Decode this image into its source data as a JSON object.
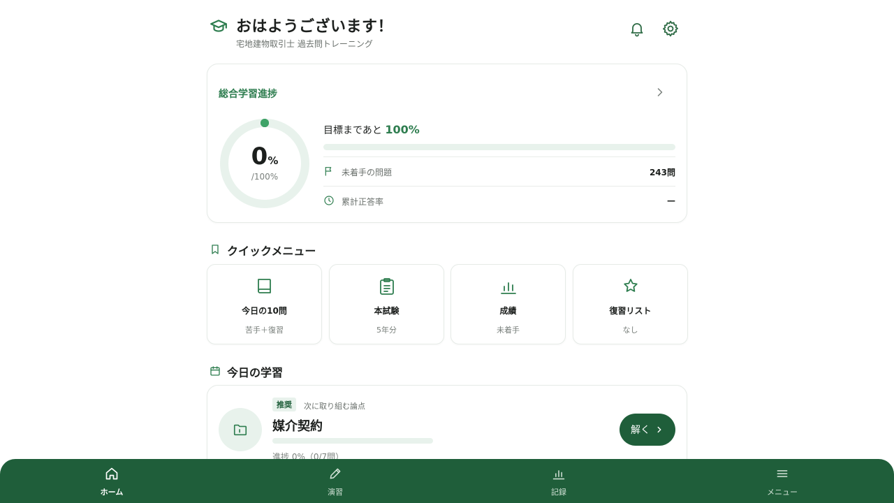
{
  "header": {
    "greeting": "おはようございます！",
    "subtitle": "宅地建物取引士 過去問トレーニング"
  },
  "progress": {
    "title": "総合学習進捗",
    "percent_value": "0",
    "percent_unit": "%",
    "percent_total": "/100%",
    "goal_prefix": "目標まであと",
    "goal_remaining": "100%",
    "progress_fraction": 0,
    "stats": [
      {
        "label": "未着手の問題",
        "value": "243問",
        "icon": "flag-icon"
      },
      {
        "label": "累計正答率",
        "value": "—",
        "icon": "clock-icon"
      }
    ]
  },
  "quick_menu": {
    "title": "クイックメニュー",
    "items": [
      {
        "title": "今日の10問",
        "sub": "苦手＋復習",
        "icon": "book-icon"
      },
      {
        "title": "本試験",
        "sub": "5年分",
        "icon": "clipboard-icon"
      },
      {
        "title": "成績",
        "sub": "未着手",
        "icon": "bar-chart-icon"
      },
      {
        "title": "復習リスト",
        "sub": "なし",
        "icon": "star-icon"
      }
    ]
  },
  "today": {
    "title": "今日の学習",
    "badge": "推奨",
    "note": "次に取り組む論点",
    "topic": "媒介契約",
    "topic_progress_fraction": 0,
    "progress_text": "進捗 0%（0/7問）",
    "button_label": "解く"
  },
  "nav": {
    "items": [
      {
        "label": "ホーム",
        "icon": "home-icon",
        "active": true
      },
      {
        "label": "演習",
        "icon": "pencil-icon",
        "active": false
      },
      {
        "label": "記録",
        "icon": "bar-chart-icon",
        "active": false
      },
      {
        "label": "メニュー",
        "icon": "menu-icon",
        "active": false
      }
    ]
  },
  "colors": {
    "accent": "#2e7d4f",
    "accent_dark": "#1f5e3a",
    "accent_light": "#e8f2ec"
  }
}
